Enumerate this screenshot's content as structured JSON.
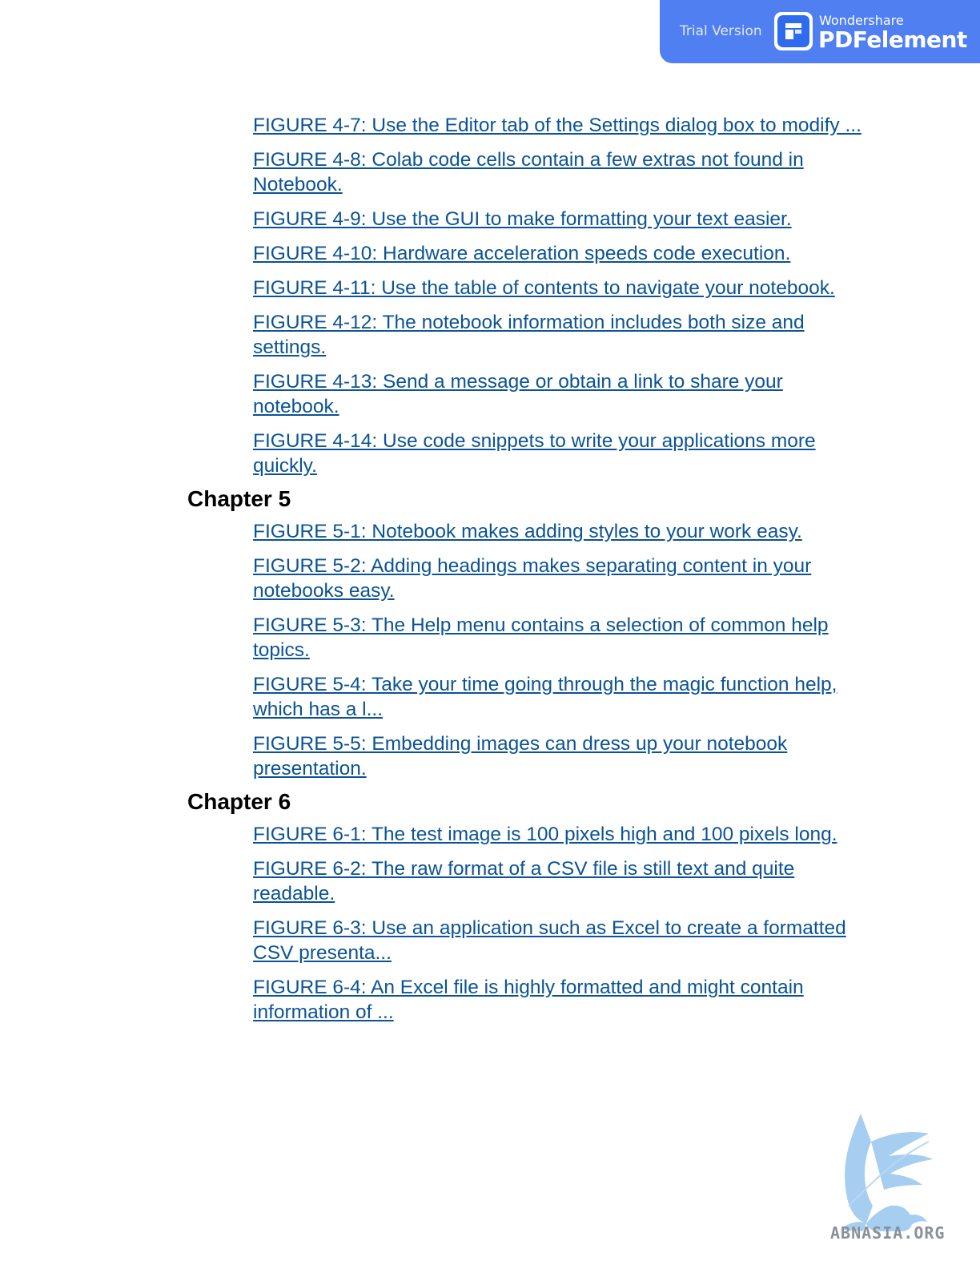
{
  "banner": {
    "trial_label": "Trial Version",
    "brand": "Wondershare",
    "product": "PDFelement",
    "color": "#4f7ff0"
  },
  "sections": {
    "ch4_items": [
      "FIGURE 4-7: Use the Editor tab of the Settings dialog box to modify ...",
      "FIGURE 4-8: Colab code cells contain a few extras not found in Notebook.",
      "FIGURE 4-9: Use the GUI to make formatting your text easier.",
      "FIGURE 4-10: Hardware acceleration speeds code execution.",
      "FIGURE 4-11: Use the table of contents to navigate your notebook.",
      "FIGURE 4-12: The notebook information includes both size and settings.",
      "FIGURE 4-13: Send a message or obtain a link to share your notebook.",
      "FIGURE 4-14: Use code snippets to write your applications more quickly."
    ],
    "ch5_heading": "Chapter 5",
    "ch5_items": [
      "FIGURE 5-1: Notebook makes adding styles to your work easy.",
      "FIGURE 5-2: Adding headings makes separating content in your notebooks easy.",
      "FIGURE 5-3: The Help menu contains a selection of common help topics.",
      "FIGURE 5-4: Take your time going through the magic function help, which has a l...",
      "FIGURE 5-5: Embedding images can dress up your notebook presentation."
    ],
    "ch6_heading": "Chapter 6",
    "ch6_items": [
      "FIGURE 6-1: The test image is 100 pixels high and 100 pixels long.",
      "FIGURE 6-2: The raw format of a CSV file is still text and quite readable.",
      "FIGURE 6-3: Use an application such as Excel to create a formatted CSV presenta...",
      "FIGURE 6-4: An Excel file is highly formatted and might contain information of ..."
    ]
  },
  "watermark": {
    "text": "ABNASIA.ORG",
    "icon": "griffin-logo-icon"
  },
  "colors": {
    "link": "#0b5394",
    "heading": "#000000"
  }
}
